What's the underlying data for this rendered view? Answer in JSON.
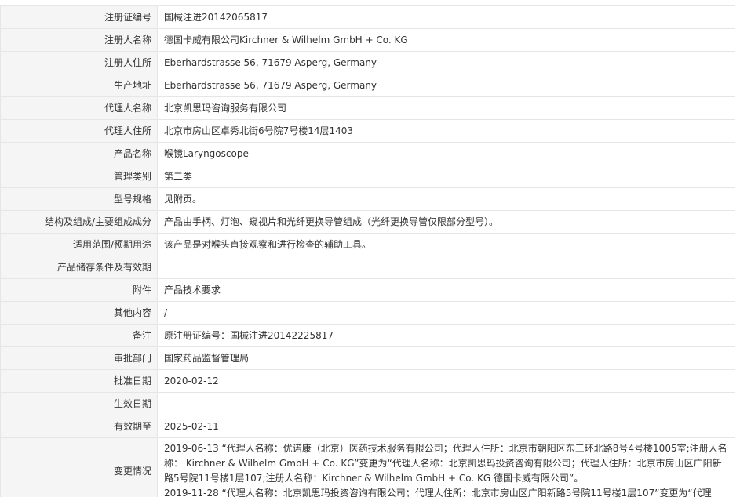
{
  "rows": [
    {
      "label": "注册证编号",
      "value": "国械注进20142065817"
    },
    {
      "label": "注册人名称",
      "value": "德国卡威有限公司Kirchner & Wilhelm GmbH + Co. KG"
    },
    {
      "label": "注册人住所",
      "value": "Eberhardstrasse 56, 71679 Asperg, Germany"
    },
    {
      "label": "生产地址",
      "value": "Eberhardstrasse 56, 71679 Asperg, Germany"
    },
    {
      "label": "代理人名称",
      "value": "北京凯思玛咨询服务有限公司"
    },
    {
      "label": "代理人住所",
      "value": "北京市房山区卓秀北街6号院7号楼14层1403"
    },
    {
      "label": "产品名称",
      "value": "喉镜Laryngoscope"
    },
    {
      "label": "管理类别",
      "value": "第二类"
    },
    {
      "label": "型号规格",
      "value": "见附页。"
    },
    {
      "label": "结构及组成/主要组成成分",
      "value": "产品由手柄、灯泡、窥视片和光纤更换导管组成（光纤更换导管仅限部分型号）。"
    },
    {
      "label": "适用范围/预期用途",
      "value": "该产品是对喉头直接观察和进行检查的辅助工具。"
    },
    {
      "label": "产品储存条件及有效期",
      "value": ""
    },
    {
      "label": "附件",
      "value": "产品技术要求"
    },
    {
      "label": "其他内容",
      "value": "/"
    },
    {
      "label": "备注",
      "value": "原注册证编号：国械注进20142225817"
    },
    {
      "label": "审批部门",
      "value": "国家药品监督管理局"
    },
    {
      "label": "批准日期",
      "value": "2020-02-12"
    },
    {
      "label": "生效日期",
      "value": ""
    },
    {
      "label": "有效期至",
      "value": "2025-02-11"
    }
  ],
  "changes": {
    "label": "变更情况",
    "entries": [
      "2019-06-13 “代理人名称：优诺康（北京）医药技术服务有限公司；代理人住所：北京市朝阳区东三环北路8号4号楼1005室;注册人名称： Kirchner & Wilhelm GmbH + Co. KG”变更为“代理人名称：北京凯思玛投资咨询有限公司；代理人住所：北京市房山区广阳新路5号院11号楼1层107;注册人名称：Kirchner & Wilhelm GmbH + Co. KG 德国卡威有限公司”。",
      "2019-11-28 “代理人名称：北京凯思玛投资咨询有限公司；代理人住所：北京市房山区广阳新路5号院11号楼1层107”变更为“代理"
    ]
  }
}
